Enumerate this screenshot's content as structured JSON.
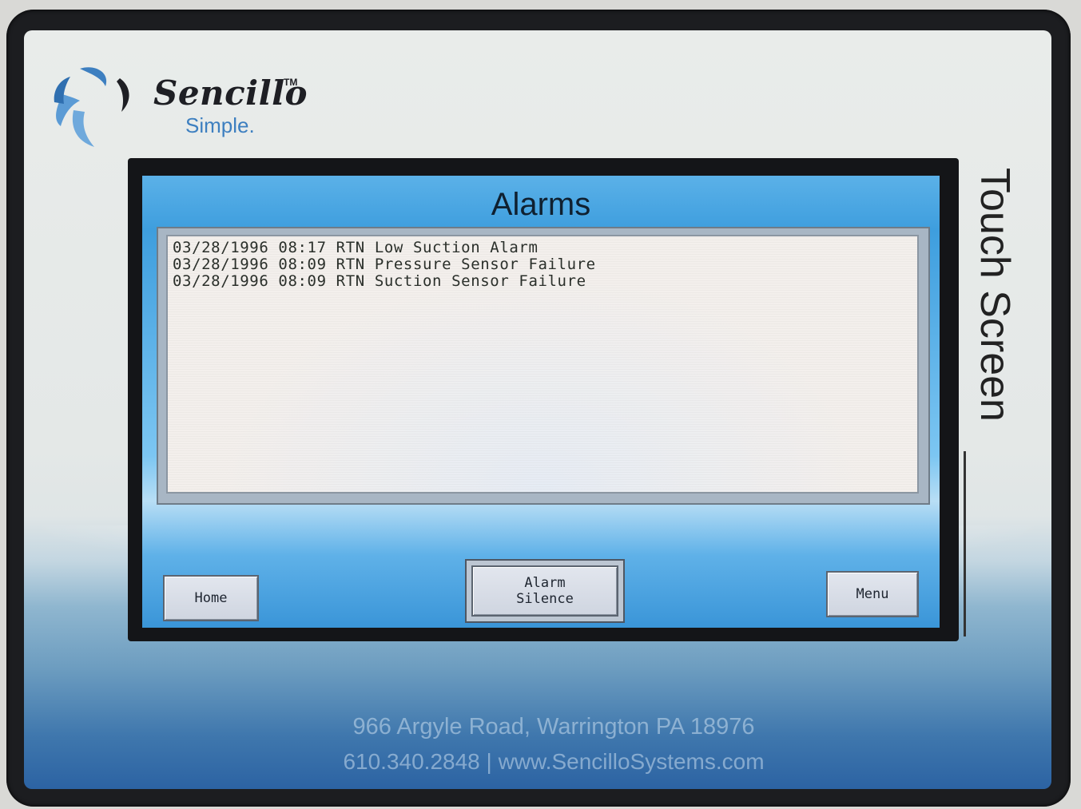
{
  "brand": {
    "name": "Sencillo",
    "trademark": "TM",
    "tagline": "Simple."
  },
  "side_label": "Touch Screen",
  "screen": {
    "title": "Alarms",
    "alarms": [
      "03/28/1996 08:17 RTN Low Suction Alarm",
      "03/28/1996 08:09 RTN Pressure Sensor Failure",
      "03/28/1996 08:09 RTN Suction Sensor Failure"
    ],
    "buttons": {
      "home": "Home",
      "alarm_silence_line1": "Alarm",
      "alarm_silence_line2": "Silence",
      "menu": "Menu"
    }
  },
  "footer": {
    "address": "966 Argyle Road, Warrington PA 18976",
    "contact": "610.340.2848  |  www.SencilloSystems.com"
  },
  "colors": {
    "screen_blue": "#3e9ede",
    "list_background": "#f3efec",
    "brand_blue": "#3d7fc0"
  }
}
